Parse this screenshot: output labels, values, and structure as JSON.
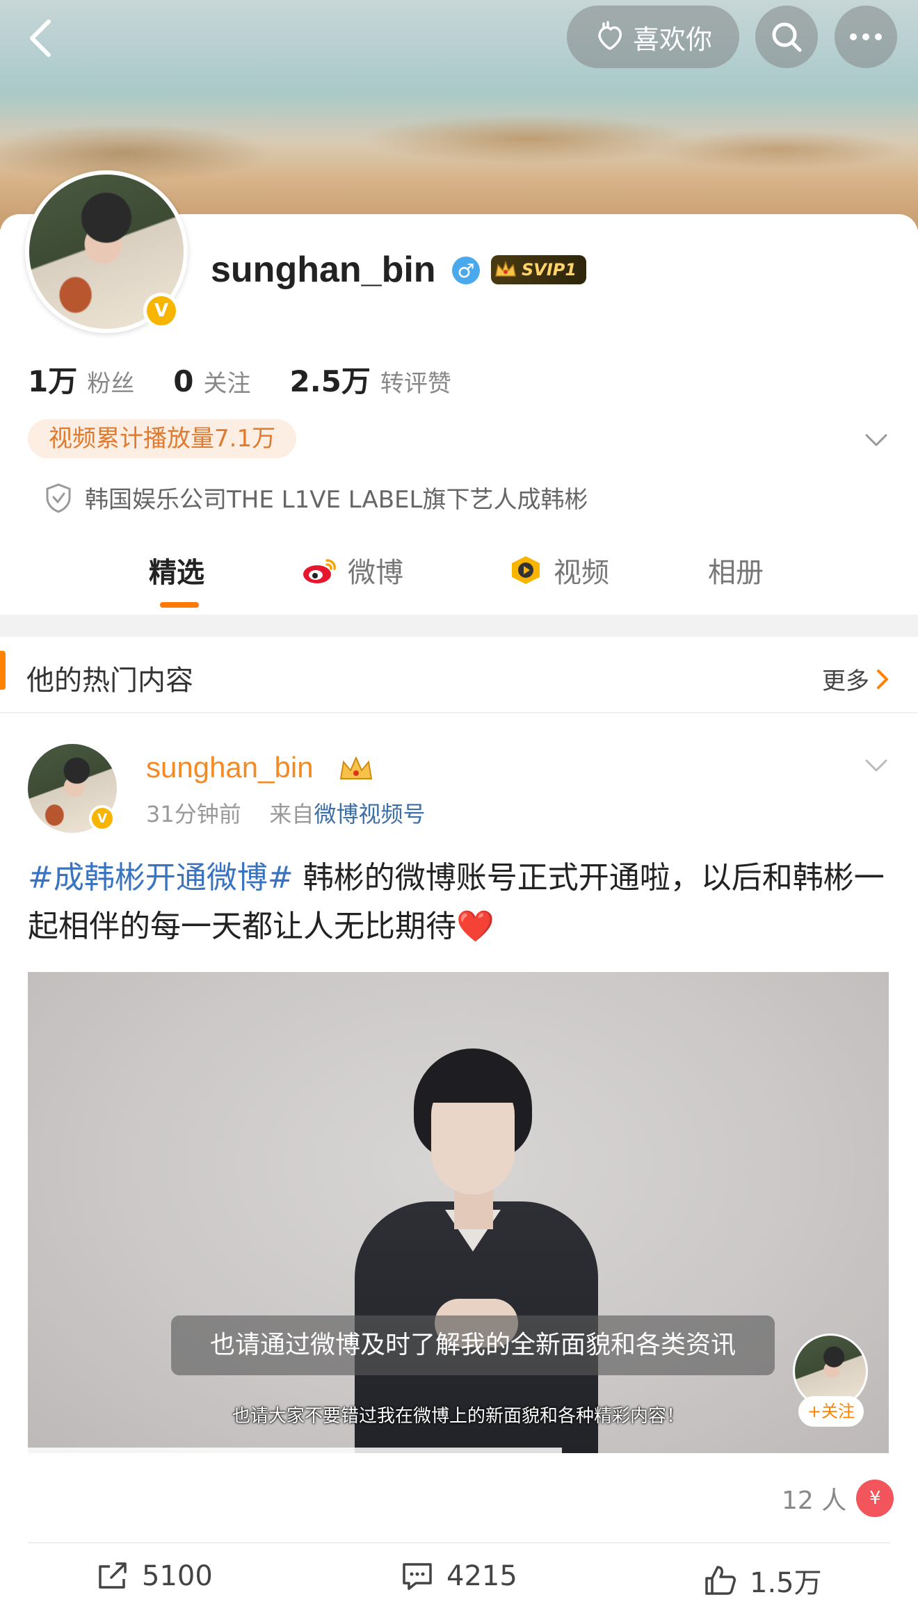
{
  "header": {
    "like_label": "喜欢你"
  },
  "profile": {
    "username": "sunghan_bin",
    "svip_label": "SVIP1",
    "stats": [
      {
        "value": "1万",
        "label": "粉丝"
      },
      {
        "value": "0",
        "label": "关注"
      },
      {
        "value": "2.5万",
        "label": "转评赞"
      }
    ],
    "play_count_tag": "视频累计播放量7.1万",
    "bio": "韩国娱乐公司THE L1VE LABEL旗下艺人成韩彬"
  },
  "tabs": [
    {
      "label": "精选",
      "icon": "none"
    },
    {
      "label": "微博",
      "icon": "weibo-icon"
    },
    {
      "label": "视频",
      "icon": "video-icon"
    },
    {
      "label": "相册",
      "icon": "none"
    }
  ],
  "hot_section": {
    "title": "他的热门内容",
    "more_label": "更多"
  },
  "post": {
    "author": "sunghan_bin",
    "time": "31分钟前",
    "source_prefix": "来自",
    "source": "微博视频号",
    "topic": "#成韩彬开通微博#",
    "text": " 韩彬的微博账号正式开通啦，以后和韩彬一起相伴的每一天都让人无比期待",
    "heart": "❤️",
    "video": {
      "subtitle_main": "也请通过微博及时了解我的全新面貌和各类资讯",
      "subtitle_secondary": "也请大家不要错过我在微博上的新面貌和各种精彩内容！",
      "follow_label": "+关注",
      "progress_fraction": 0.62
    },
    "likes_people": "12 人",
    "actions": {
      "repost": "5100",
      "comment": "4215",
      "like": "1.5万"
    }
  },
  "colors": {
    "accent": "#ff8200",
    "topic_link": "#3a74c0",
    "author_name": "#f28b26",
    "verified": "#f7b500"
  }
}
